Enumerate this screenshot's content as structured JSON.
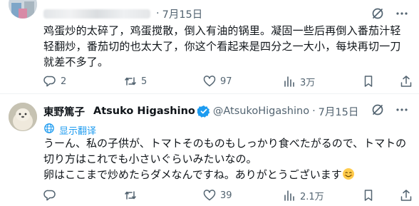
{
  "tweet1": {
    "date": "7月15日",
    "text": "鸡蛋炒的太碎了，鸡蛋搅散，倒入有油的锅里。凝固一些后再倒入番茄汁轻轻翻炒，番茄切的也太大了，你这个看起来是四分之一大小，每块再切一刀就差不多了。",
    "stats": {
      "replies": "2",
      "retweets": "5",
      "likes": "97",
      "views": "3万"
    }
  },
  "tweet2": {
    "name": "東野篤子",
    "latin_name": "Atsuko Higashino",
    "handle": "@AtsukoHigashino",
    "date": "7月15日",
    "translate_label": "显示翻译",
    "lines": [
      "うーん、私の子供が、トマトそのものもしっかり食べたがるので、トマトの",
      "切り方はこれでも小さいぐらいみたいなの。",
      "卵はここまで炒めたらダメなんですね。ありがとうございます"
    ],
    "stats": {
      "replies": "",
      "retweets": "",
      "likes": "39",
      "views": "2.1万"
    }
  },
  "colors": {
    "text": "#0f1419",
    "muted": "#536471",
    "accent": "#1d9bf0",
    "verified": "#1d9bf0",
    "border": "#eff3f4"
  },
  "icons": [
    "grok-icon",
    "more-icon",
    "reply-icon",
    "retweet-icon",
    "like-icon",
    "views-icon",
    "bookmark-icon",
    "share-icon",
    "verified-icon",
    "globe-icon",
    "smiling-emoji-icon"
  ]
}
